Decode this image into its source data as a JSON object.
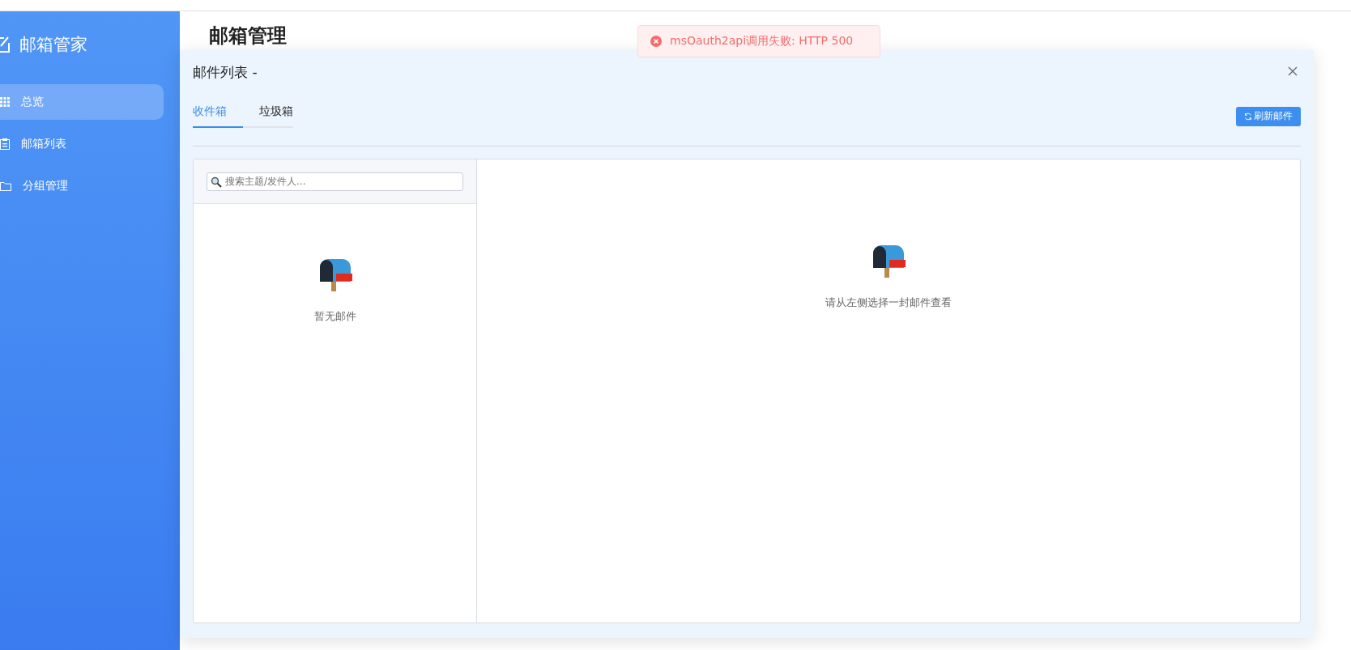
{
  "sidebar": {
    "brand": "邮箱管家",
    "items": [
      {
        "label": "总览",
        "kind": "grid",
        "selected": true
      },
      {
        "label": "邮箱列表",
        "kind": "clipboard",
        "selected": false
      },
      {
        "label": "分组管理",
        "kind": "folder",
        "selected": false
      }
    ]
  },
  "page_title": "邮箱管理",
  "toast": {
    "kind": "error",
    "message": "msOauth2api调用失败: HTTP 500"
  },
  "dialog": {
    "title": "邮件列表 -",
    "tabs": [
      {
        "label": "收件箱",
        "selected": true
      },
      {
        "label": "垃圾箱",
        "selected": false
      }
    ],
    "refresh_button": "刷新邮件",
    "search": {
      "placeholder": "搜索主题/发件人..."
    },
    "list_empty": "暂无邮件",
    "detail_empty": "请从左侧选择一封邮件查看"
  }
}
